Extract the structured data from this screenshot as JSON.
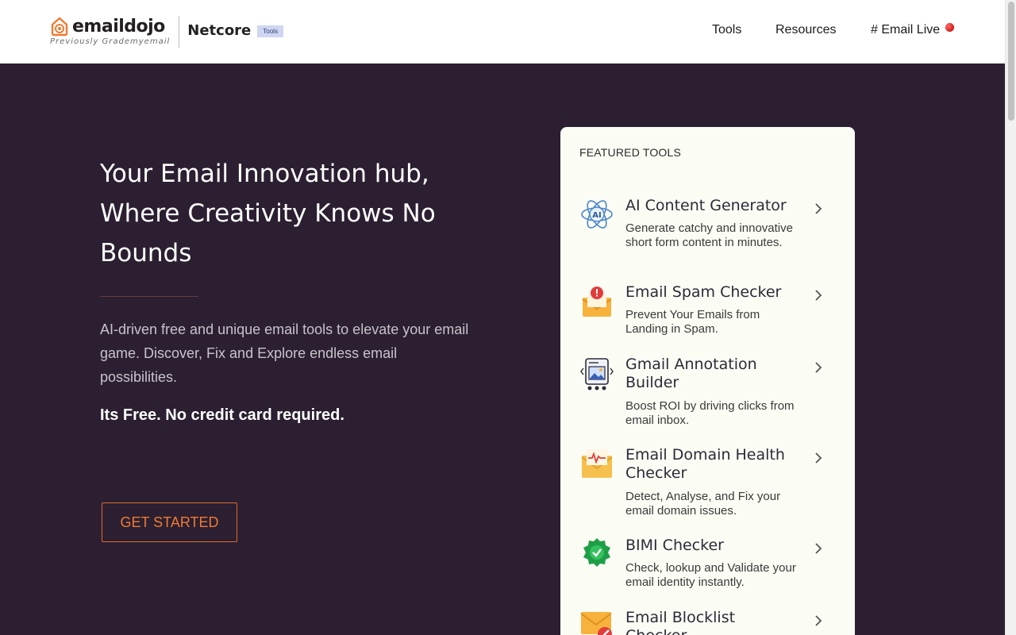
{
  "header": {
    "logo_text": "emaildojo",
    "logo_subtitle": "Previously Grademyemail",
    "partner": "Netcore",
    "badge": "Tools",
    "nav": [
      {
        "label": "Tools"
      },
      {
        "label": "Resources"
      },
      {
        "label": "# Email Live"
      }
    ]
  },
  "hero": {
    "title": "Your Email Innovation hub, Where Creativity Knows No Bounds",
    "description": "AI-driven free and unique email tools to elevate your email game. Discover, Fix and Explore endless email possibilities.",
    "free_note": "Its Free. No credit card required.",
    "cta_label": "GET STARTED"
  },
  "featured": {
    "heading": "FEATURED TOOLS",
    "tools": [
      {
        "name": "AI Content Generator",
        "desc": "Generate catchy and innovative short form content in minutes.",
        "icon": "ai-atom-icon"
      },
      {
        "name": "Email Spam Checker",
        "desc": "Prevent Your Emails from Landing in Spam.",
        "icon": "envelope-alert-icon"
      },
      {
        "name": "Gmail Annotation Builder",
        "desc": "Boost ROI by driving clicks from email inbox.",
        "icon": "carousel-image-icon"
      },
      {
        "name": "Email Domain Health Checker",
        "desc": "Detect, Analyse, and Fix your email domain issues.",
        "icon": "envelope-pulse-icon"
      },
      {
        "name": "BIMI Checker",
        "desc": "Check, lookup and Validate your email identity instantly.",
        "icon": "verified-badge-icon"
      },
      {
        "name": "Email Blocklist Checker",
        "desc": "",
        "icon": "envelope-block-icon"
      }
    ]
  },
  "colors": {
    "background": "#2b1f31",
    "accent": "#f07a33",
    "panel": "#fbfcf4",
    "live_dot": "#d11a1a"
  }
}
